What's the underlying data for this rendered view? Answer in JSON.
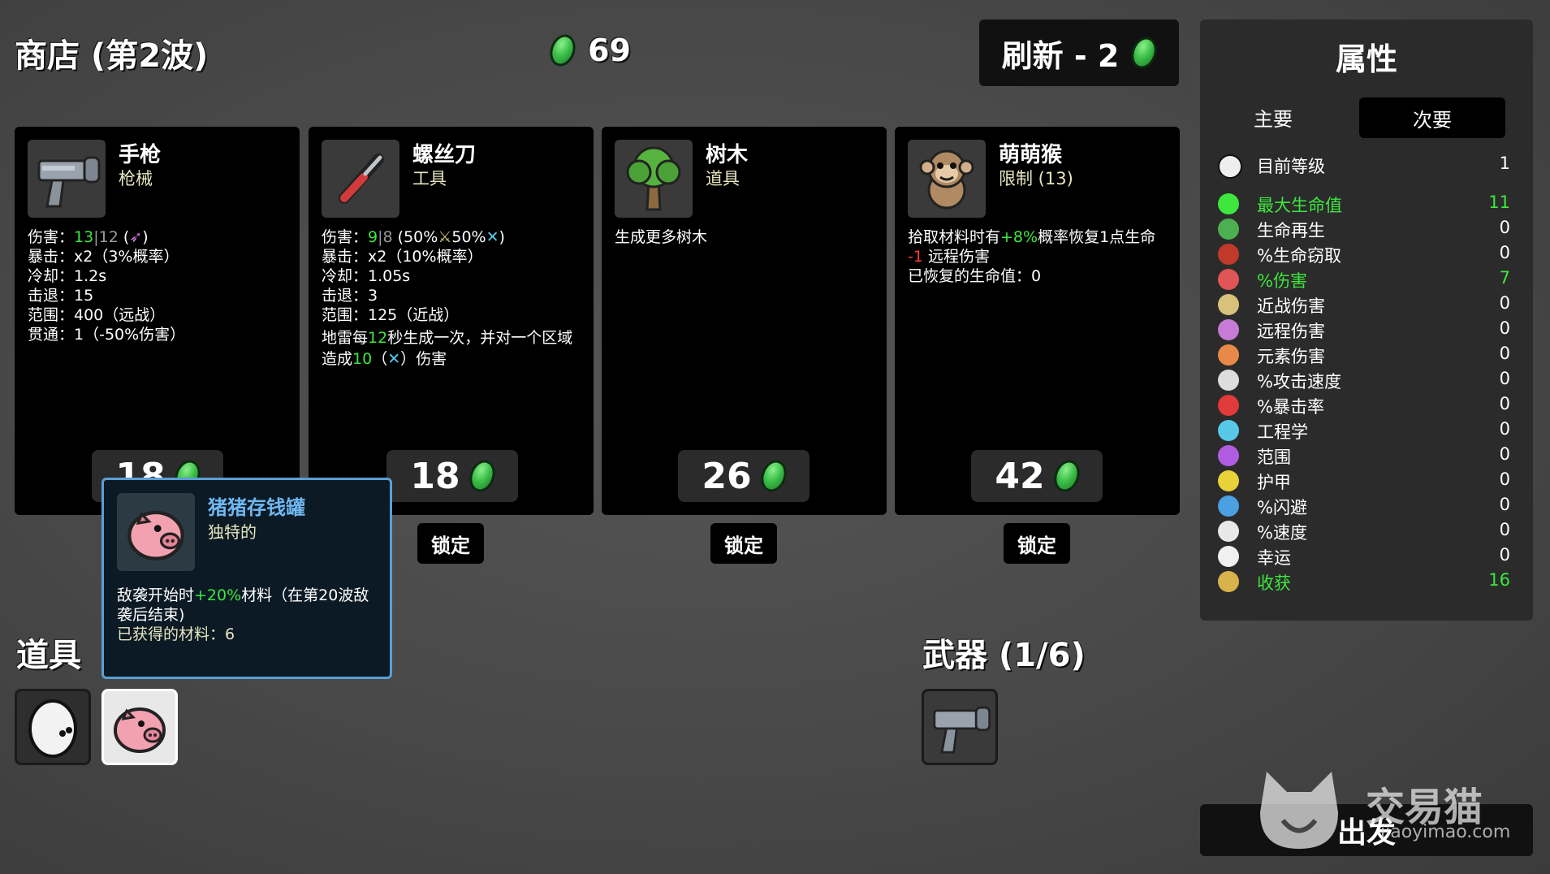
{
  "header": {
    "shop_title": "商店 (第2波)",
    "materials": "69",
    "reroll_label": "刷新 - 2"
  },
  "cards": [
    {
      "name": "手枪",
      "type": "枪械",
      "price": "18",
      "icon": "pistol-icon",
      "lines": [
        {
          "label": "伤害：",
          "v1": "13",
          "sep": "|",
          "v2": "12",
          "extra": "("
        },
        {
          "text": "暴击：x2（3%概率）"
        },
        {
          "text": "冷却：1.2s"
        },
        {
          "text": "击退：15"
        },
        {
          "text": "范围：400（远战）"
        },
        {
          "text": "贯通：1（-50%伤害）"
        }
      ]
    },
    {
      "name": "螺丝刀",
      "type": "工具",
      "price": "18",
      "lock_label": "锁定",
      "icon": "screwdriver-icon",
      "lines": [
        {
          "label": "伤害：",
          "v1": "9",
          "sep": "|",
          "v2": "8",
          "extra": "(50%",
          "extra2": "50%",
          "extra3": ")"
        },
        {
          "text": "暴击：x2（10%概率）"
        },
        {
          "text": "冷却：1.05s"
        },
        {
          "text": "击退：3"
        },
        {
          "text": "范围：125（近战）"
        },
        {
          "t1": "地雷每",
          "g1": "12",
          "t2": "秒生成一次，并对一个区域"
        },
        {
          "t1": "造成",
          "g1": "10",
          "t2": "（",
          "t3": "）伤害"
        }
      ]
    },
    {
      "name": "树木",
      "type": "道具",
      "price": "26",
      "lock_label": "锁定",
      "icon": "tree-icon",
      "desc": "生成更多树木"
    },
    {
      "name": "萌萌猴",
      "type": "限制 (13)",
      "price": "42",
      "lock_label": "锁定",
      "icon": "monkey-icon",
      "line1_a": "拾取材料时有",
      "line1_g": "+8%",
      "line1_b": "概率恢复1点生命",
      "line2_r": "-1",
      "line2_b": " 远程伤害",
      "line3": "已恢复的生命值：0"
    }
  ],
  "tooltip": {
    "name": "猪猪存钱罐",
    "rarity": "独特的",
    "line1_a": "敌袭开始时",
    "line1_g": "+20%",
    "line1_b": "材料（在第20波敌",
    "line2": "袭后结束)",
    "line3": "已获得的材料：6"
  },
  "items_section": {
    "title": "道具"
  },
  "weapons_section": {
    "title": "武器 (1/6)"
  },
  "go_button": {
    "label": "出发"
  },
  "stats_panel": {
    "title": "属性",
    "tab_primary": "主要",
    "tab_secondary": "次要",
    "level_label": "目前等级",
    "level_value": "1",
    "rows": [
      {
        "label": "最大生命值",
        "value": "11",
        "highlight": true,
        "icon": "heart-icon",
        "color": "#3ee63e"
      },
      {
        "label": "生命再生",
        "value": "0",
        "highlight": false,
        "icon": "regen-icon",
        "color": "#4caf50"
      },
      {
        "label": "%生命窃取",
        "value": "0",
        "highlight": false,
        "icon": "lifesteal-icon",
        "color": "#c0392b"
      },
      {
        "label": "%伤害",
        "value": "7",
        "highlight": true,
        "icon": "damage-icon",
        "color": "#e05555"
      },
      {
        "label": "近战伤害",
        "value": "0",
        "highlight": false,
        "icon": "melee-icon",
        "color": "#d8c27a"
      },
      {
        "label": "远程伤害",
        "value": "0",
        "highlight": false,
        "icon": "ranged-icon",
        "color": "#c67bd6"
      },
      {
        "label": "元素伤害",
        "value": "0",
        "highlight": false,
        "icon": "elemental-icon",
        "color": "#e8894a"
      },
      {
        "label": "%攻击速度",
        "value": "0",
        "highlight": false,
        "icon": "attack-speed-icon",
        "color": "#dddddd"
      },
      {
        "label": "%暴击率",
        "value": "0",
        "highlight": false,
        "icon": "crit-icon",
        "color": "#e03a3a"
      },
      {
        "label": "工程学",
        "value": "0",
        "highlight": false,
        "icon": "engineering-icon",
        "color": "#58c8e8"
      },
      {
        "label": "范围",
        "value": "0",
        "highlight": false,
        "icon": "range-icon",
        "color": "#b05ce0"
      },
      {
        "label": "护甲",
        "value": "0",
        "highlight": false,
        "icon": "armor-icon",
        "color": "#e8d23a"
      },
      {
        "label": "%闪避",
        "value": "0",
        "highlight": false,
        "icon": "dodge-icon",
        "color": "#4aa0e0"
      },
      {
        "label": "%速度",
        "value": "0",
        "highlight": false,
        "icon": "speed-icon",
        "color": "#e8e8e8"
      },
      {
        "label": "幸运",
        "value": "0",
        "highlight": false,
        "icon": "luck-icon",
        "color": "#f0f0f0"
      },
      {
        "label": "收获",
        "value": "16",
        "highlight": true,
        "icon": "harvest-icon",
        "color": "#d8b24a"
      }
    ]
  },
  "watermark": {
    "brand": "交易猫",
    "url": "jiaoyimao.com"
  },
  "colors": {
    "green": "#3ee63e",
    "red": "#ff3b3b",
    "tooltip_border": "#5b9fd6",
    "tooltip_name": "#6fb8f0"
  }
}
